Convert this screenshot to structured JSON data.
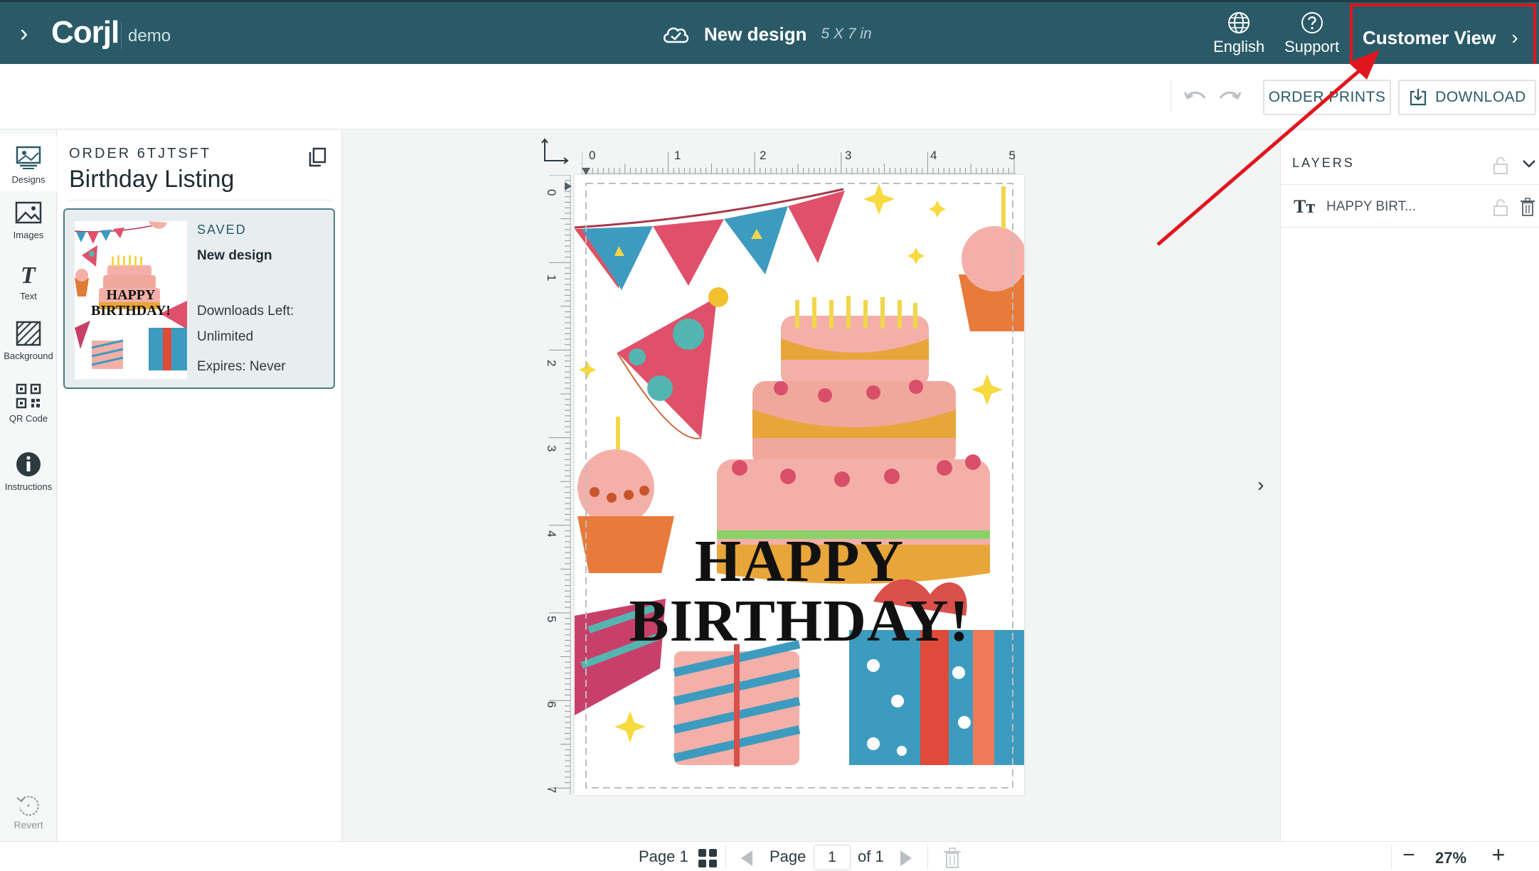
{
  "header": {
    "logo": "Corjl",
    "demo_label": "demo",
    "design_title": "New design",
    "design_size": "5 X 7 in",
    "language_label": "English",
    "support_label": "Support",
    "customer_view_label": "Customer View"
  },
  "toolbar": {
    "order_prints_label": "ORDER PRINTS",
    "download_label": "DOWNLOAD"
  },
  "rail": {
    "items": [
      {
        "label": "Designs",
        "icon": "designs-icon"
      },
      {
        "label": "Images",
        "icon": "image-icon"
      },
      {
        "label": "Text",
        "icon": "text-icon"
      },
      {
        "label": "Background",
        "icon": "background-icon"
      },
      {
        "label": "QR Code",
        "icon": "qr-code-icon"
      },
      {
        "label": "Instructions",
        "icon": "info-icon"
      }
    ],
    "revert_label": "Revert"
  },
  "panel": {
    "order_label": "ORDER 6TJTSFT",
    "listing_title": "Birthday Listing",
    "card": {
      "status": "SAVED",
      "name": "New design",
      "downloads_label": "Downloads Left:",
      "downloads_value": "Unlimited",
      "expires": "Expires: Never",
      "thumb_line1": "HAPPY",
      "thumb_line2": "BIRTHDAY!"
    }
  },
  "canvas": {
    "ruler_h": [
      "0",
      "1",
      "2",
      "3",
      "4",
      "5"
    ],
    "ruler_v": [
      "0",
      "1",
      "2",
      "3",
      "4",
      "5",
      "6",
      "7"
    ],
    "text_line1": "HAPPY",
    "text_line2": "BIRTHDAY!"
  },
  "layers": {
    "title": "LAYERS",
    "items": [
      {
        "name": "HAPPY BIRT..."
      }
    ]
  },
  "bottom": {
    "page_label": "Page 1",
    "page_word": "Page",
    "page_value": "1",
    "of_label": "of 1",
    "zoom": "27%"
  },
  "colors": {
    "header_bg": "#2a5a67",
    "accent": "#2a5a67",
    "annotation": "#e0161e"
  }
}
